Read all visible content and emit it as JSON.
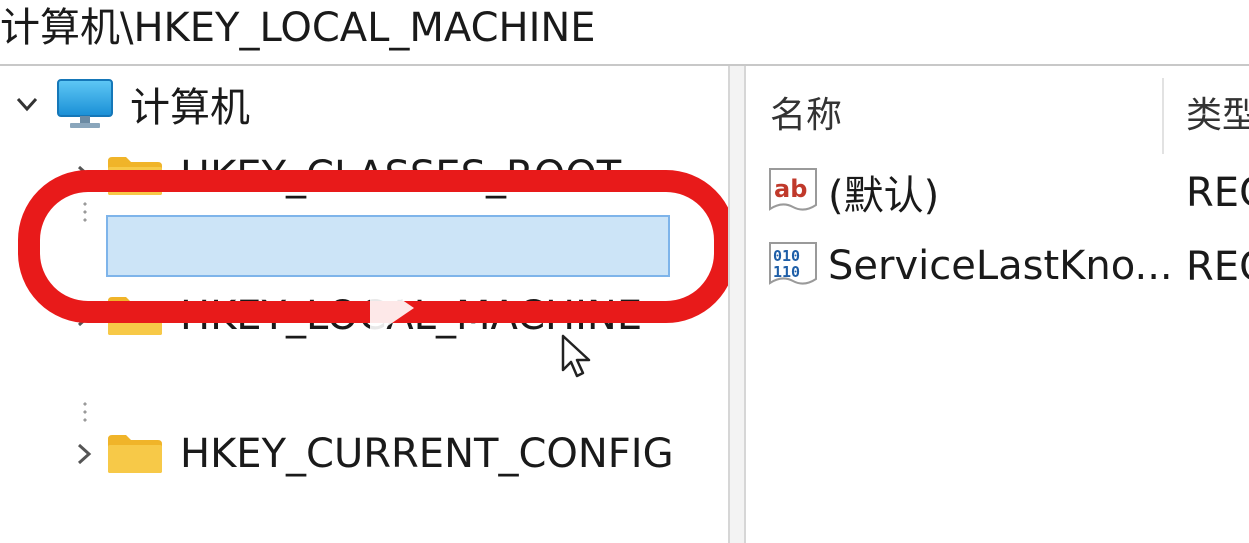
{
  "address_bar": {
    "path": "计算机\\HKEY_LOCAL_MACHINE"
  },
  "tree": {
    "root": {
      "label": "计算机",
      "icon": "computer-icon",
      "expanded": true
    },
    "items": [
      {
        "label": "HKEY_CLASSES_ROOT",
        "icon": "folder-icon",
        "expanded": false
      },
      {
        "label": "HKEY_LOCAL_MACHINE",
        "icon": "folder-icon",
        "expanded": false,
        "selected": true
      },
      {
        "label": "HKEY_CURRENT_CONFIG",
        "icon": "folder-icon",
        "expanded": false
      }
    ]
  },
  "list": {
    "columns": [
      "名称",
      "类型"
    ],
    "rows": [
      {
        "name": "(默认)",
        "type": "REG",
        "icon": "string-value-icon"
      },
      {
        "name": "ServiceLastKno...",
        "type": "REG",
        "icon": "binary-value-icon"
      }
    ]
  },
  "colors": {
    "highlight_ring": "#e81a1a",
    "selection_fill": "#cce4f7",
    "selection_border": "#7eb4ea",
    "folder": "#f5c542"
  }
}
